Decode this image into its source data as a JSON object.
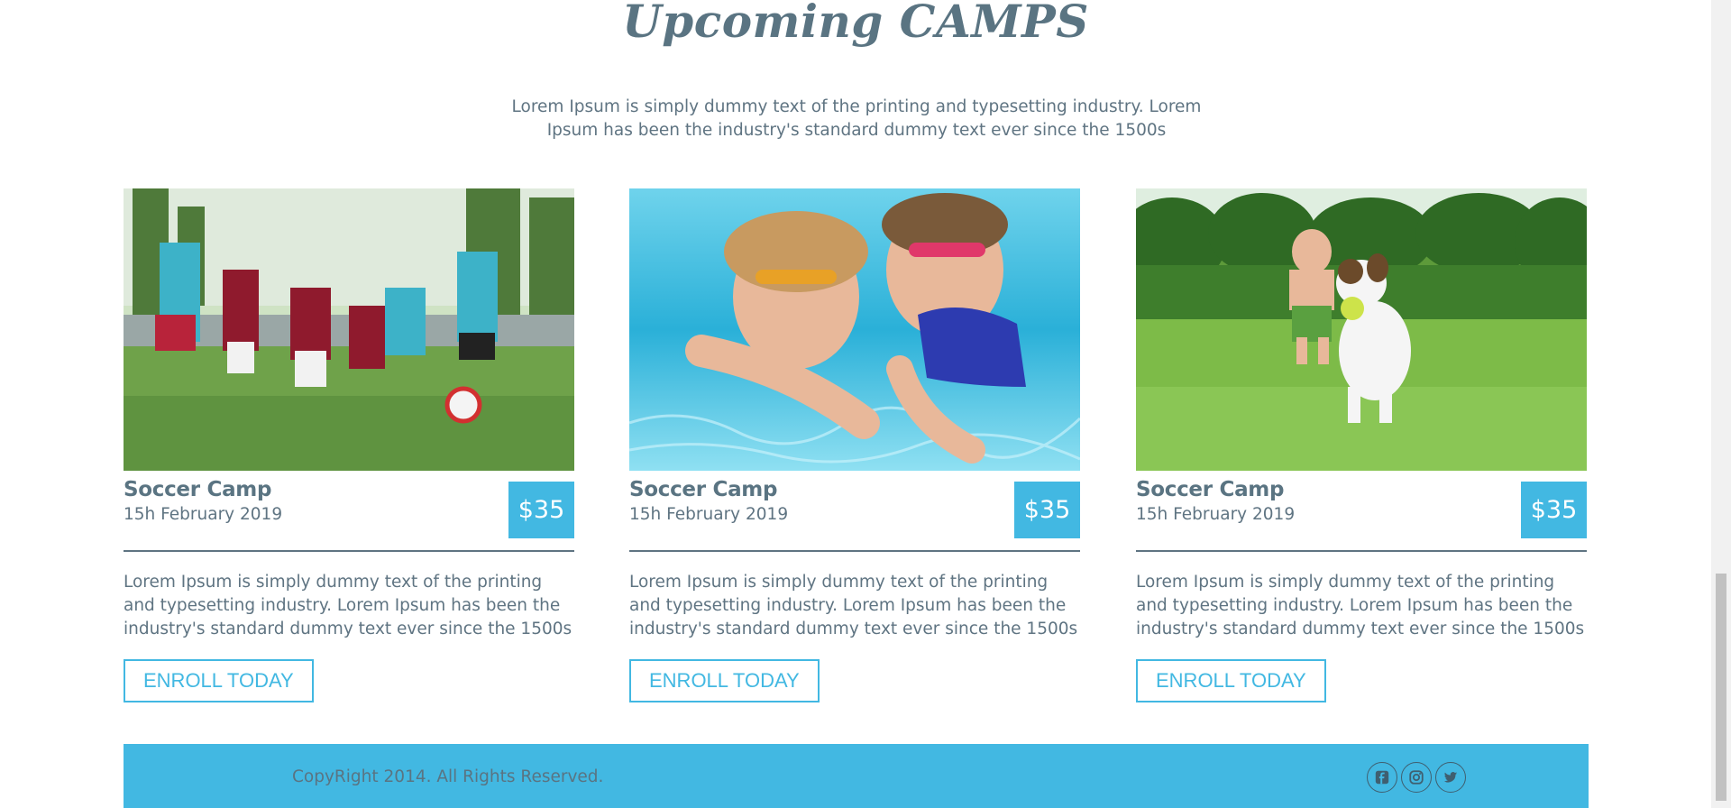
{
  "section": {
    "heading": "Upcoming CAMPS",
    "intro": "Lorem Ipsum is simply dummy text of the printing and typesetting industry. Lorem Ipsum has been the industry's standard dummy text ever since the 1500s"
  },
  "camps": [
    {
      "image": "kids-playing-soccer",
      "title": "Soccer Camp",
      "date": "15h February 2019",
      "price": "$35",
      "description": "Lorem Ipsum is simply dummy text of the printing and typesetting industry. Lorem Ipsum has been the industry's standard dummy text ever since the 1500s",
      "button": "ENROLL TODAY"
    },
    {
      "image": "kids-swimming-underwater",
      "title": "Soccer Camp",
      "date": "15h February 2019",
      "price": "$35",
      "description": "Lorem Ipsum is simply dummy text of the printing and typesetting industry. Lorem Ipsum has been the industry's standard dummy text ever since the 1500s",
      "button": "ENROLL TODAY"
    },
    {
      "image": "boy-running-with-dog",
      "title": "Soccer Camp",
      "date": "15h February 2019",
      "price": "$35",
      "description": "Lorem Ipsum is simply dummy text of the printing and typesetting industry. Lorem Ipsum has been the industry's standard dummy text ever since the 1500s",
      "button": "ENROLL TODAY"
    }
  ],
  "footer": {
    "copyright": "CopyRight 2014. All Rights Reserved.",
    "social": [
      "facebook-icon",
      "instagram-icon",
      "twitter-icon"
    ]
  },
  "colors": {
    "accent": "#42b8e2",
    "text": "#5f7482",
    "heading": "#5a7482"
  }
}
